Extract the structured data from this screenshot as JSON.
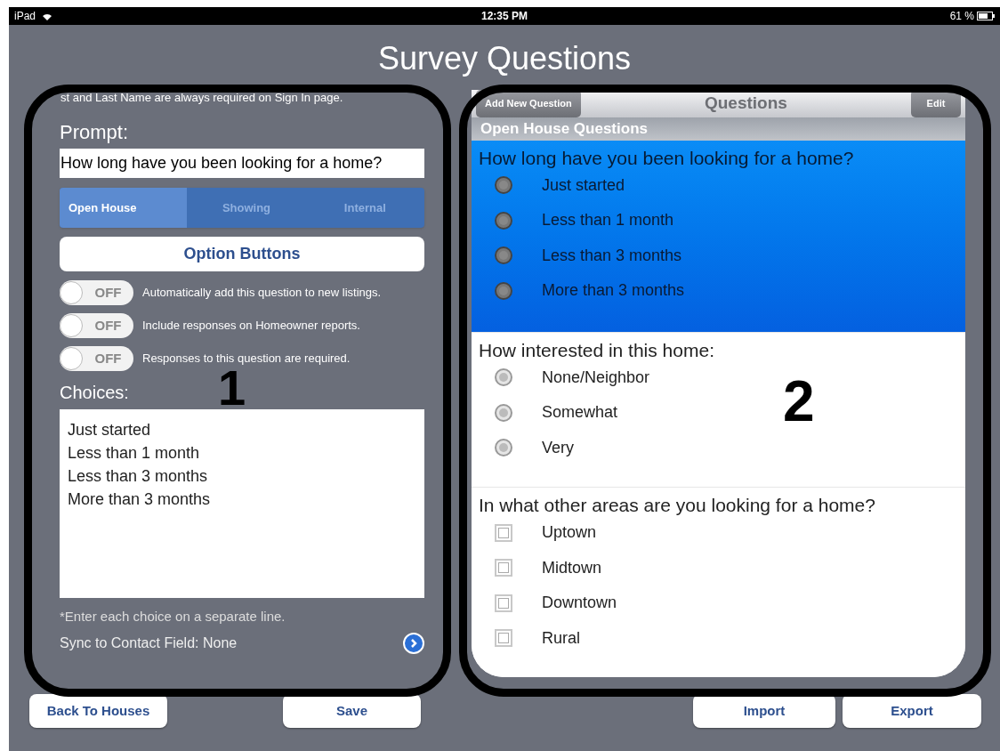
{
  "status_bar": {
    "device": "iPad",
    "time": "12:35 PM",
    "battery": "61 %"
  },
  "title": "Survey Questions",
  "editor": {
    "note": "st and Last Name are always required on Sign In page.",
    "prompt_label": "Prompt:",
    "prompt_value": "How long have you been looking for a home?",
    "segments": [
      {
        "label": "Open House",
        "selected": true
      },
      {
        "label": "Showing",
        "selected": false
      },
      {
        "label": "Internal",
        "selected": false
      }
    ],
    "type_button": "Option Buttons",
    "toggles": [
      {
        "state": "OFF",
        "on": false,
        "label": "Automatically add this question to new listings."
      },
      {
        "state": "OFF",
        "on": false,
        "label": "Include responses on Homeowner reports."
      },
      {
        "state": "OFF",
        "on": false,
        "label": "Responses to this question are required."
      }
    ],
    "choices_label": "Choices:",
    "choices": [
      "Just started",
      "Less than 1 month",
      "Less than 3 months",
      "More than 3 months"
    ],
    "hint": "*Enter each choice on a separate line.",
    "sync": "Sync to Contact Field: None"
  },
  "preview": {
    "add_button": "Add New Question",
    "title": "Questions",
    "edit_button": "Edit",
    "section": "Open House Questions",
    "questions": [
      {
        "text": "How long have you been looking for a home?",
        "kind": "radio",
        "selected": true,
        "options": [
          {
            "label": "Just started",
            "checked": false
          },
          {
            "label": "Less than 1 month",
            "checked": false
          },
          {
            "label": "Less than 3 months",
            "checked": false
          },
          {
            "label": "More than 3 months",
            "checked": false
          }
        ]
      },
      {
        "text": "How interested in this home:",
        "kind": "radio",
        "selected": false,
        "options": [
          {
            "label": "None/Neighbor",
            "checked": false
          },
          {
            "label": "Somewhat",
            "checked": false
          },
          {
            "label": "Very",
            "checked": false
          }
        ]
      },
      {
        "text": "In what other areas are you looking for a home?",
        "kind": "checkbox",
        "selected": false,
        "options": [
          {
            "label": "Uptown",
            "checked": false
          },
          {
            "label": "Midtown",
            "checked": false
          },
          {
            "label": "Downtown",
            "checked": false
          },
          {
            "label": "Rural",
            "checked": false
          }
        ]
      }
    ]
  },
  "left_buttons": [
    "Back To Houses",
    "Save"
  ],
  "right_buttons": [
    "Import",
    "Export"
  ],
  "callouts": [
    "1",
    "2"
  ]
}
